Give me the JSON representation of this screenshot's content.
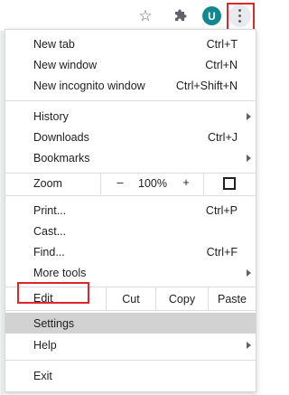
{
  "toolbar": {
    "star_glyph": "☆",
    "avatar_letter": "U",
    "accent_color": "#12878f",
    "highlight_color": "#e0262b"
  },
  "menu": {
    "new_tab": {
      "label": "New tab",
      "shortcut": "Ctrl+T"
    },
    "new_window": {
      "label": "New window",
      "shortcut": "Ctrl+N"
    },
    "new_incognito": {
      "label": "New incognito window",
      "shortcut": "Ctrl+Shift+N"
    },
    "history": {
      "label": "History"
    },
    "downloads": {
      "label": "Downloads",
      "shortcut": "Ctrl+J"
    },
    "bookmarks": {
      "label": "Bookmarks"
    },
    "zoom": {
      "label": "Zoom",
      "minus": "–",
      "value": "100%",
      "plus": "+"
    },
    "print": {
      "label": "Print...",
      "shortcut": "Ctrl+P"
    },
    "cast": {
      "label": "Cast..."
    },
    "find": {
      "label": "Find...",
      "shortcut": "Ctrl+F"
    },
    "more_tools": {
      "label": "More tools"
    },
    "edit": {
      "label": "Edit",
      "cut": "Cut",
      "copy": "Copy",
      "paste": "Paste"
    },
    "settings": {
      "label": "Settings"
    },
    "help": {
      "label": "Help"
    },
    "exit": {
      "label": "Exit"
    }
  }
}
